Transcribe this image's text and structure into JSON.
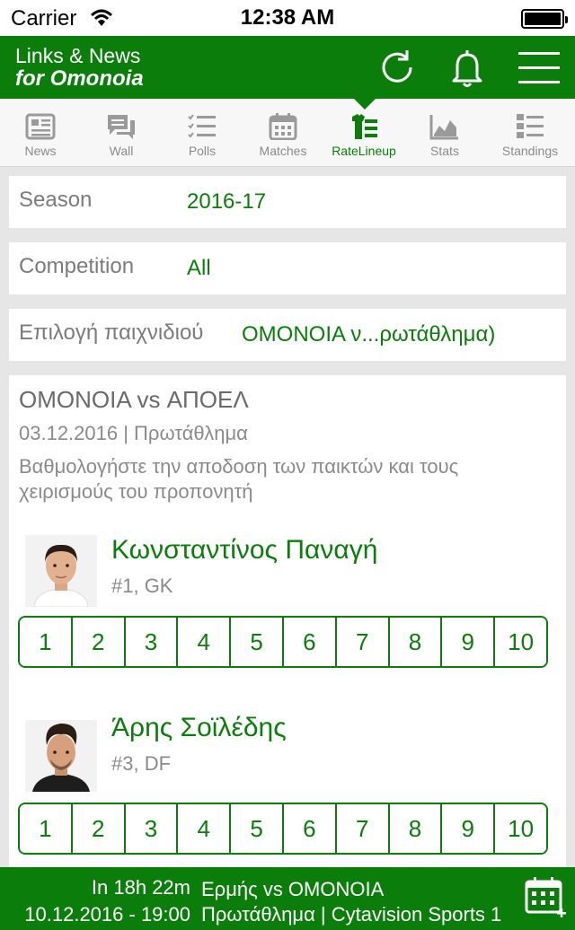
{
  "status": {
    "carrier": "Carrier",
    "time": "12:38 AM"
  },
  "app": {
    "title_line1": "Links & News",
    "title_line2": "for Omonoia"
  },
  "colors": {
    "brand": "#0a7d0a",
    "inactive": "#8a8a8a"
  },
  "tabs": [
    {
      "label": "News",
      "icon": "news-icon"
    },
    {
      "label": "Wall",
      "icon": "wall-icon"
    },
    {
      "label": "Polls",
      "icon": "polls-icon"
    },
    {
      "label": "Matches",
      "icon": "calendar-icon"
    },
    {
      "label": "RateLineup",
      "icon": "jersey-icon",
      "active": true
    },
    {
      "label": "Stats",
      "icon": "chart-icon"
    },
    {
      "label": "Standings",
      "icon": "standings-icon"
    }
  ],
  "filters": {
    "season": {
      "label": "Season",
      "value": "2016-17"
    },
    "competition": {
      "label": "Competition",
      "value": "All"
    },
    "game": {
      "label": "Επιλογή παιχνιδιού",
      "value": "ΟΜΟΝΟΙΑ ν...ρωτάθλημα)"
    }
  },
  "match": {
    "title": "ΟΜΟΝΟΙΑ vs ΑΠΟΕΛ",
    "meta": "03.12.2016 | Πρωτάθλημα",
    "instructions": "Βαθμολογήστε την αποδοση των παικτών και τους χειρισμούς του προπονητή"
  },
  "rating_options": [
    "1",
    "2",
    "3",
    "4",
    "5",
    "6",
    "7",
    "8",
    "9",
    "10"
  ],
  "players": [
    {
      "name": "Κωνσταντίνος Παναγή",
      "position": "#1, GK"
    },
    {
      "name": "Άρης Σοϊλέδης",
      "position": "#3, DF"
    }
  ],
  "next_match": {
    "countdown": "In 18h 22m",
    "datetime": "10.12.2016 - 19:00",
    "teams": "Ερμής vs ΟΜΟΝΟΙΑ",
    "details": "Πρωτάθλημα | Cytavision Sports 1"
  }
}
